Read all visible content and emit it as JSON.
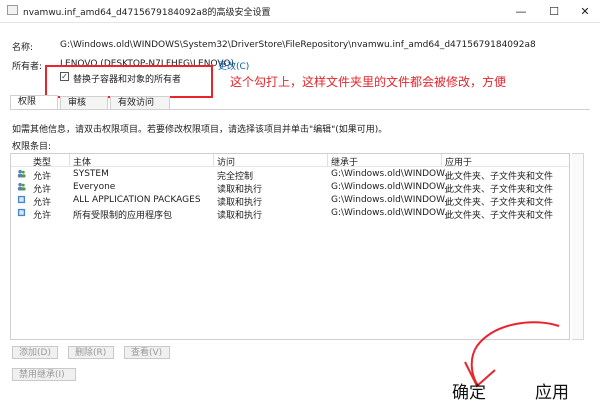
{
  "window": {
    "title": "nvamwu.inf_amd64_d4715679184092a8的高级安全设置",
    "minimize": "—",
    "maximize": "☐",
    "close": "✕"
  },
  "info": {
    "name_label": "名称:",
    "name_value": "G:\\Windows.old\\WINDOWS\\System32\\DriverStore\\FileRepository\\nvamwu.inf_amd64_d4715679184092a8",
    "owner_label": "所有者:",
    "owner_value": "LENOVO (DESKTOP-N7LFHFG\\LENOVO)",
    "change_link": "更改(C)",
    "replace_owner_checkbox": "替换子容器和对象的所有者",
    "replace_owner_checked": true
  },
  "annotation": "这个勾打上，这样文件夹里的文件都会被修改，方便",
  "tabs": [
    {
      "label": "权限",
      "active": true
    },
    {
      "label": "审核",
      "active": false
    },
    {
      "label": "有效访问",
      "active": false
    }
  ],
  "instructions": "如需其他信息，请双击权限项目。若要修改权限项目，请选择该项目并单击\"编辑\"(如果可用)。",
  "entries_label": "权限条目:",
  "table": {
    "headers": [
      "类型",
      "主体",
      "访问",
      "继承于",
      "应用于"
    ],
    "rows": [
      {
        "type": "允许",
        "principal": "SYSTEM",
        "access": "完全控制",
        "inherited": "G:\\Windows.old\\WINDOW...",
        "applies": "此文件夹、子文件夹和文件"
      },
      {
        "type": "允许",
        "principal": "Everyone",
        "access": "读取和执行",
        "inherited": "G:\\Windows.old\\WINDOW...",
        "applies": "此文件夹、子文件夹和文件"
      },
      {
        "type": "允许",
        "principal": "ALL APPLICATION PACKAGES",
        "access": "读取和执行",
        "inherited": "G:\\Windows.old\\WINDOW...",
        "applies": "此文件夹、子文件夹和文件"
      },
      {
        "type": "允许",
        "principal": "所有受限制的应用程序包",
        "access": "读取和执行",
        "inherited": "G:\\Windows.old\\WINDOW...",
        "applies": "此文件夹、子文件夹和文件"
      }
    ]
  },
  "buttons": {
    "add": "添加(D)",
    "remove": "删除(R)",
    "view": "查看(V)",
    "disable_inheritance": "禁用继承(I)"
  },
  "footer": {
    "ok": "确定",
    "apply": "应用"
  },
  "colors": {
    "annotation_red": "#e8242c",
    "link_blue": "#0b5ea8"
  }
}
